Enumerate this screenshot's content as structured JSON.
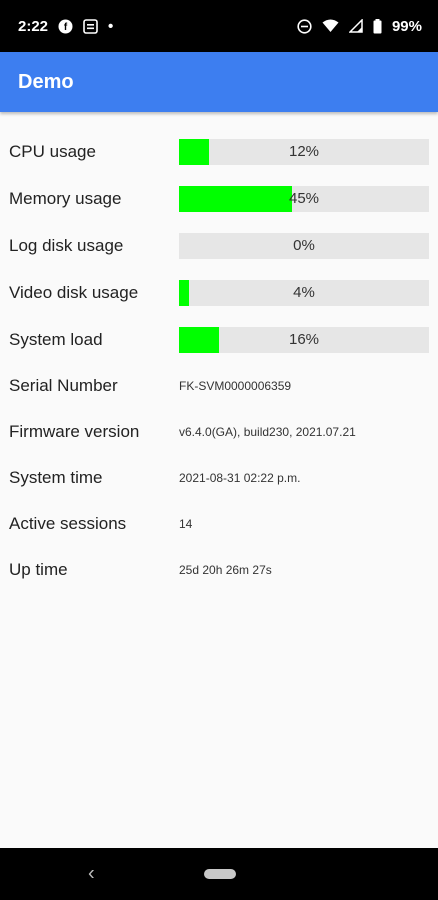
{
  "status_bar": {
    "time": "2:22",
    "dot": "•",
    "battery": "99%",
    "icons": [
      "f-circle-icon",
      "calendar-icon",
      "do-not-disturb-icon",
      "wifi-icon",
      "signal-icon",
      "battery-icon"
    ]
  },
  "app_bar": {
    "title": "Demo"
  },
  "metrics": [
    {
      "label": "CPU usage",
      "value": "12%",
      "percent": 12
    },
    {
      "label": "Memory usage",
      "value": "45%",
      "percent": 45
    },
    {
      "label": "Log disk usage",
      "value": "0%",
      "percent": 0
    },
    {
      "label": "Video disk usage",
      "value": "4%",
      "percent": 4
    },
    {
      "label": "System load",
      "value": "16%",
      "percent": 16
    }
  ],
  "info": [
    {
      "label": "Serial Number",
      "value": "FK-SVM0000006359"
    },
    {
      "label": "Firmware version",
      "value": "v6.4.0(GA), build230, 2021.07.21"
    },
    {
      "label": "System time",
      "value": "2021-08-31 02:22 p.m."
    },
    {
      "label": "Active sessions",
      "value": "14"
    },
    {
      "label": "Up time",
      "value": "25d 20h 26m 27s"
    }
  ],
  "colors": {
    "app_bar": "#3d7ef0",
    "bar_fill": "#00ff00",
    "bar_track": "#e6e6e6"
  },
  "nav": {
    "back_glyph": "‹"
  }
}
